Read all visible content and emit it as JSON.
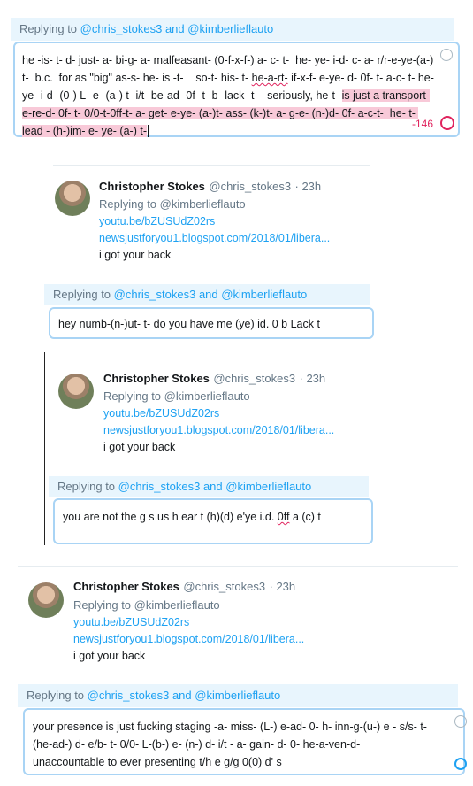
{
  "composer1": {
    "reply_prefix": "Replying to ",
    "reply_mentions": "@chris_stokes3 and @kimberlieflauto",
    "text_a": "he -is- t- d- just- a- bi-g- a- malfeasant- (0-f-x-f-) a- c- t-  he- ye- i-d- c- a- r/r-e-ye-(a-) t-  b.c.  for as \"big\" as-s- he- is -t-    so-t- his- t- ",
    "text_squig": "he-a-rt-",
    "text_b": " if-x-f- e-ye- d- 0f- t- a-c- t- he-ye- i-d- (0-) L- e- (a-) t- i/t- be-ad- 0f- t- b- lack- t-   seriously, he-t- ",
    "text_hl": "is just a transport-e-re-d- 0f- t- 0/0-t-0ff-t- a- get- e-ye- (a-)t- ass- (k-)t- a- g-e- (n-)d- 0f- a-c-t-  he- t- lead - (h-)im- e- ye- (a-) t-",
    "counter": "-146"
  },
  "tweet1": {
    "name": "Christopher Stokes",
    "handle": "@chris_stokes3",
    "time": "· 23h",
    "replying": "Replying to @kimberlieflauto",
    "link1": "youtu.be/bZUSUdZ02rs",
    "link2": "newsjustforyou1.blogspot.com/2018/01/libera...",
    "body": "i got your back"
  },
  "reply2": {
    "reply_prefix": "Replying to ",
    "reply_mentions": "@chris_stokes3 and @kimberlieflauto",
    "text": "hey numb-(n-)ut- t-  do you have  me (ye) id. 0 b Lack t"
  },
  "tweet2": {
    "name": "Christopher Stokes",
    "handle": "@chris_stokes3",
    "time": "· 23h",
    "replying": "Replying to @kimberlieflauto",
    "link1": "youtu.be/bZUSUdZ02rs",
    "link2": "newsjustforyou1.blogspot.com/2018/01/libera...",
    "body": "i got your back"
  },
  "reply3": {
    "reply_prefix": "Replying to ",
    "reply_mentions": "@chris_stokes3 and @kimberlieflauto",
    "text_a": "you are not the g s us h ear t (h)(d) e'ye i.d. ",
    "text_squig": "0ff",
    "text_b": " a (c) t"
  },
  "tweet3": {
    "name": "Christopher Stokes",
    "handle": "@chris_stokes3",
    "time": "· 23h",
    "replying": "Replying to @kimberlieflauto",
    "link1": "youtu.be/bZUSUdZ02rs",
    "link2": "newsjustforyou1.blogspot.com/2018/01/libera...",
    "body": "i got your back"
  },
  "reply4": {
    "reply_prefix": "Replying to ",
    "reply_mentions": "@chris_stokes3 and @kimberlieflauto",
    "line1": "your presence is just fucking staging -a- miss- (L-) e-ad- 0- h- inn-g-(u-) e - s/s- t-",
    "line2": "(he-ad-) d- e/b- t- 0/0- L-(b-) e- (n-) d- i/t - a- gain- d- 0- he-a-ven-d-",
    "line3": " unaccountable to ever presenting t/h e g/g 0(0) d' s"
  },
  "colors": {
    "accent": "#1da1f2",
    "reply_bar_bg": "#e8f5fd",
    "highlight": "#f8c9d8",
    "counter": "#e0245e"
  }
}
